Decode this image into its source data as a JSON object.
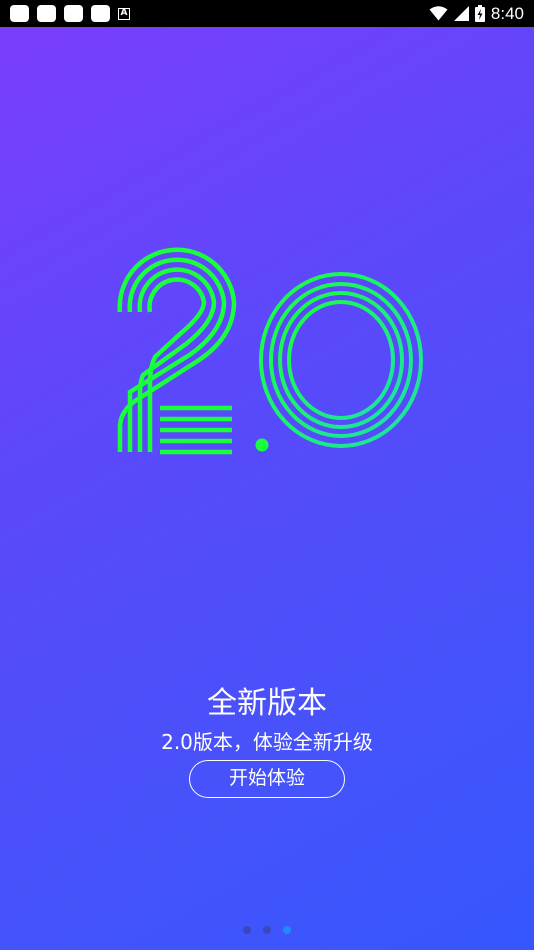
{
  "status_bar": {
    "time": "8:40",
    "notification_icons": [
      "notification-icon",
      "notification-icon",
      "notification-icon",
      "notification-icon"
    ],
    "a_icon_text": "A",
    "icons": [
      "wifi-icon",
      "cell-signal-icon",
      "battery-icon"
    ]
  },
  "splash": {
    "logo_alt": "2.0",
    "title": "全新版本",
    "subtitle": "2.0版本，体验全新升级",
    "start_button": "开始体验",
    "colors": {
      "logo_green": "#19ff3c",
      "logo_teal": "#1de2a8",
      "text": "#ffffff"
    }
  },
  "pager": {
    "pages": 3,
    "active_index": 2
  }
}
